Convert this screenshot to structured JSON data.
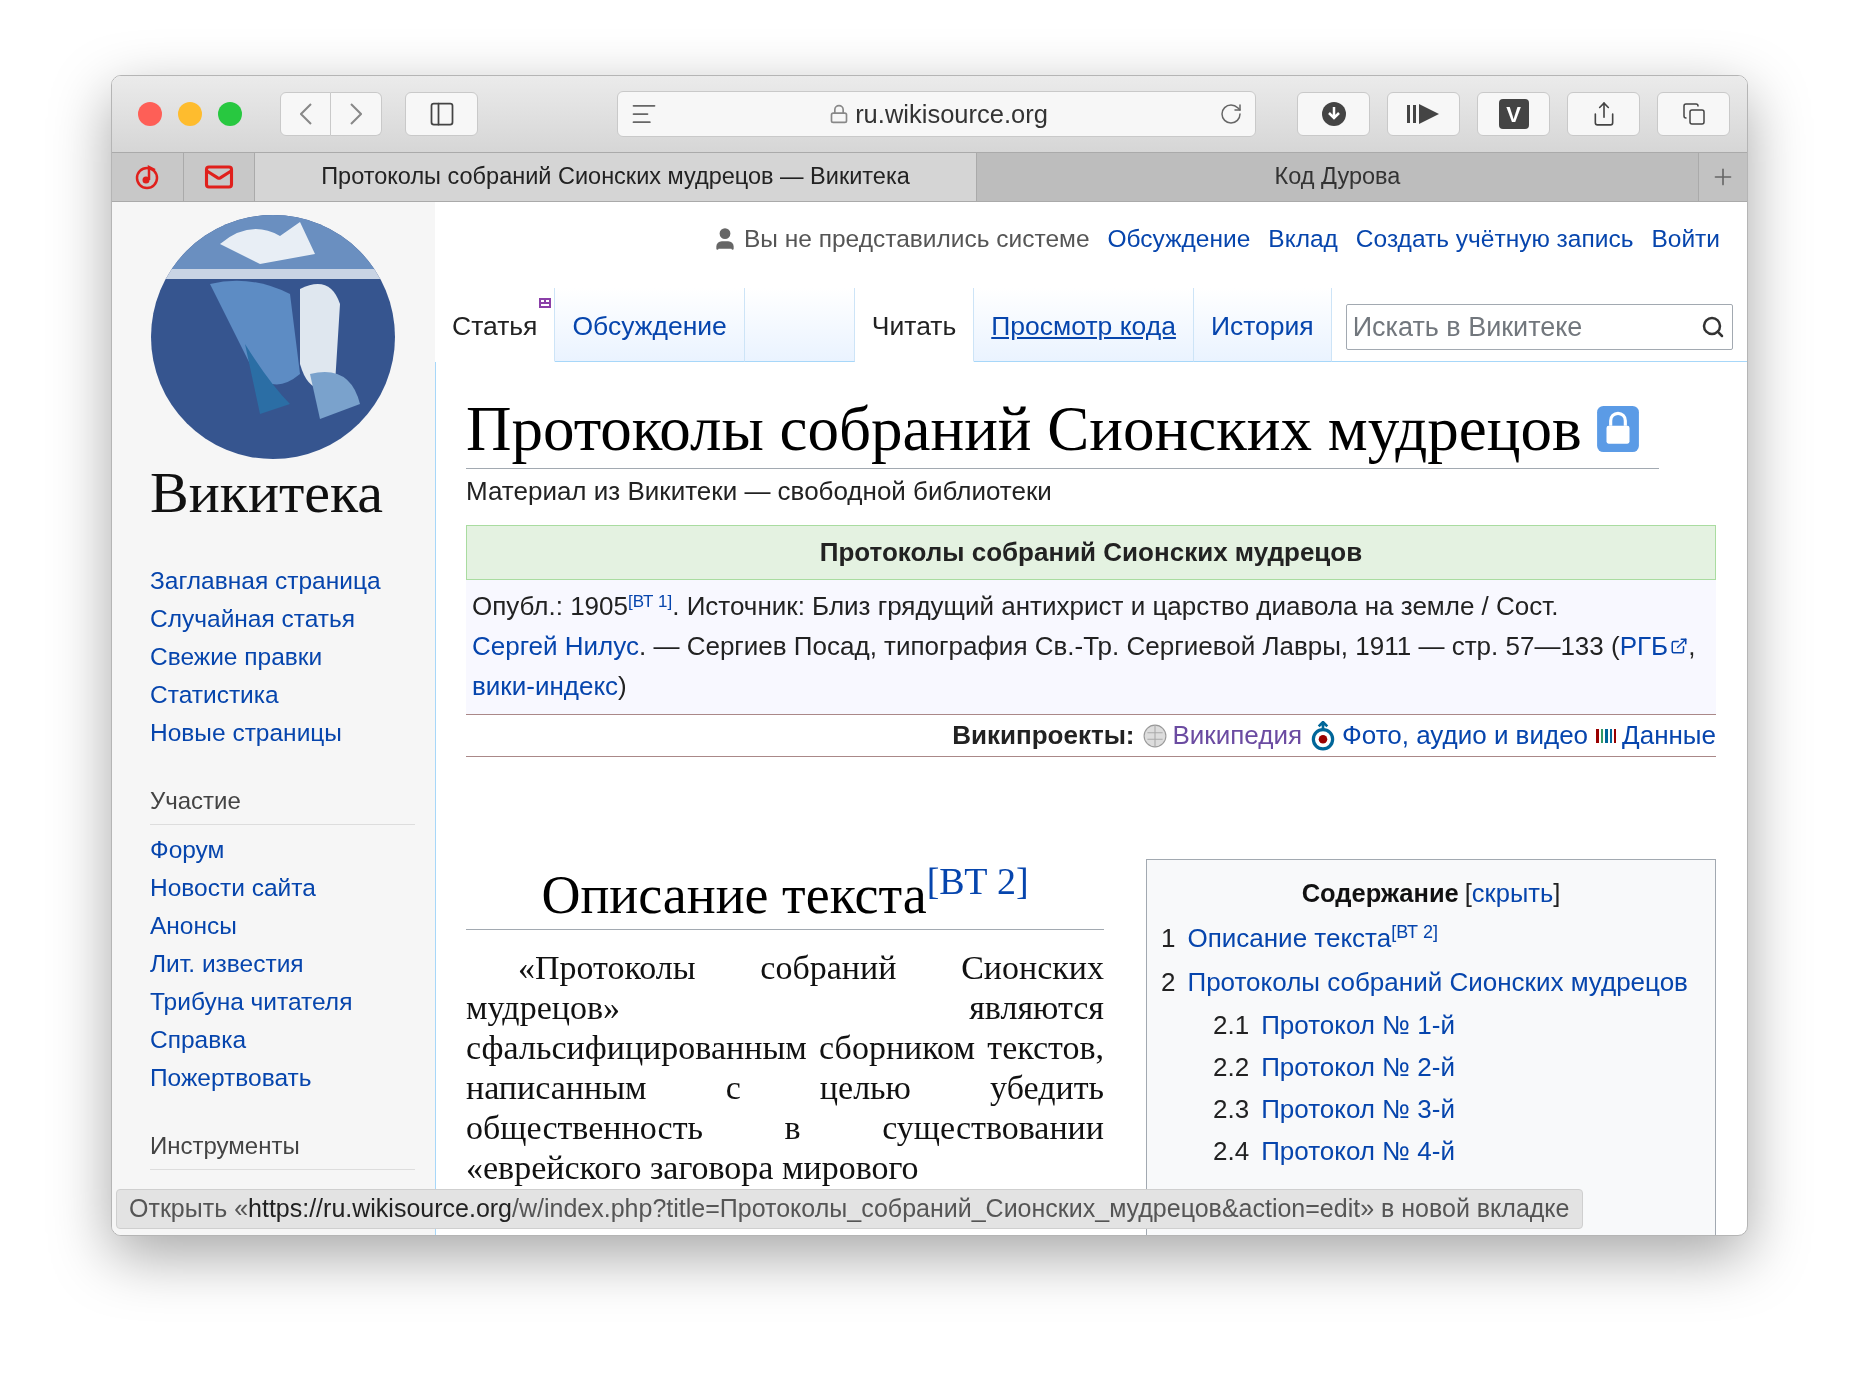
{
  "browser": {
    "url": "ru.wikisource.org",
    "extension_label": "V",
    "tabs": [
      {
        "title": "Протоколы собраний Сионских мудрецов — Викитека",
        "selected": true
      },
      {
        "title": "Код Дурова",
        "selected": false
      }
    ]
  },
  "user_bar": {
    "status": "Вы не представились системе",
    "links": [
      "Обсуждение",
      "Вклад",
      "Создать учётную запись",
      "Войти"
    ]
  },
  "sidebar": {
    "logo_text": "Викитека",
    "main_links": [
      "Заглавная страница",
      "Случайная статья",
      "Свежие правки",
      "Статистика",
      "Новые страницы"
    ],
    "sections": [
      {
        "heading": "Участие",
        "links": [
          "Форум",
          "Новости сайта",
          "Анонсы",
          "Лит. известия",
          "Трибуна читателя",
          "Справка",
          "Пожертвовать"
        ]
      },
      {
        "heading": "Инструменты"
      }
    ]
  },
  "page_tabs": [
    {
      "label": "Статья",
      "selected": true
    },
    {
      "label": "Обсуждение",
      "selected": false
    }
  ],
  "view_tabs": [
    {
      "label": "Читать",
      "selected": true,
      "underlined": false
    },
    {
      "label": "Просмотр кода",
      "selected": false,
      "underlined": true
    },
    {
      "label": "История",
      "selected": false,
      "underlined": false
    }
  ],
  "search": {
    "placeholder": "Искать в Викитеке"
  },
  "article": {
    "title": "Протоколы собраний Сионских мудрецов",
    "protected": true,
    "tagline": "Материал из Викитеки — свободной библиотеки",
    "header": {
      "title": "Протоколы собраний Сионских мудрецов",
      "source": [
        {
          "kind": "plain",
          "text": "Опубл.: 1905"
        },
        {
          "kind": "ref",
          "text": "[ВТ 1]"
        },
        {
          "kind": "plain",
          "text": ". Источник: Близ грядущий антихрист и царство диавола на земле / Сост. "
        },
        {
          "kind": "link",
          "text": "Сергей Нилус"
        },
        {
          "kind": "plain",
          "text": ". — Сергиев Посад, типография Св.-Тр. Сергиевой Лавры, 1911 — стр. 57—133 ("
        },
        {
          "kind": "external",
          "text": "РГБ"
        },
        {
          "kind": "plain",
          "text": ", "
        },
        {
          "kind": "link",
          "text": "вики-индекс"
        },
        {
          "kind": "plain",
          "text": ")"
        }
      ],
      "projects_label": "Википроекты:",
      "projects": [
        {
          "kind": "wikipedia",
          "label": "Википедия",
          "visited": true
        },
        {
          "kind": "commons",
          "label": "Фото, аудио и видео",
          "visited": false
        },
        {
          "kind": "wikidata",
          "label": "Данные",
          "visited": false
        }
      ]
    },
    "section": {
      "heading": "Описание текста",
      "ref": "[ВТ 2]",
      "paragraph": "«Протоколы собраний Сионских мудрецов» являются сфальсифицированным сборником текстов, написанным с целью убедить общественность в существовании «еврейского заговора мирового"
    }
  },
  "toc": {
    "title": "Содержание",
    "toggle": "скрыть",
    "brackets": [
      "[",
      "]"
    ],
    "items": [
      {
        "number": "1",
        "label": "Описание текста",
        "ref": "[ВТ 2]"
      },
      {
        "number": "2",
        "label": "Протоколы собраний Сионских мудрецов",
        "children": [
          {
            "number": "2.1",
            "label": "Протокол № 1-й"
          },
          {
            "number": "2.2",
            "label": "Протокол № 2-й"
          },
          {
            "number": "2.3",
            "label": "Протокол № 3-й"
          },
          {
            "number": "2.4",
            "label": "Протокол № 4-й"
          }
        ]
      }
    ]
  },
  "status_bar": {
    "parts": [
      {
        "kind": "plain",
        "text": "Открыть «"
      },
      {
        "kind": "host",
        "text": "https://ru.wikisource.org"
      },
      {
        "kind": "plain",
        "text": "/w/index.php?title=Протоколы_собраний_Сионских_мудрецов&action=edit"
      },
      {
        "kind": "plain",
        "text": "» в новой вкладке"
      }
    ]
  }
}
